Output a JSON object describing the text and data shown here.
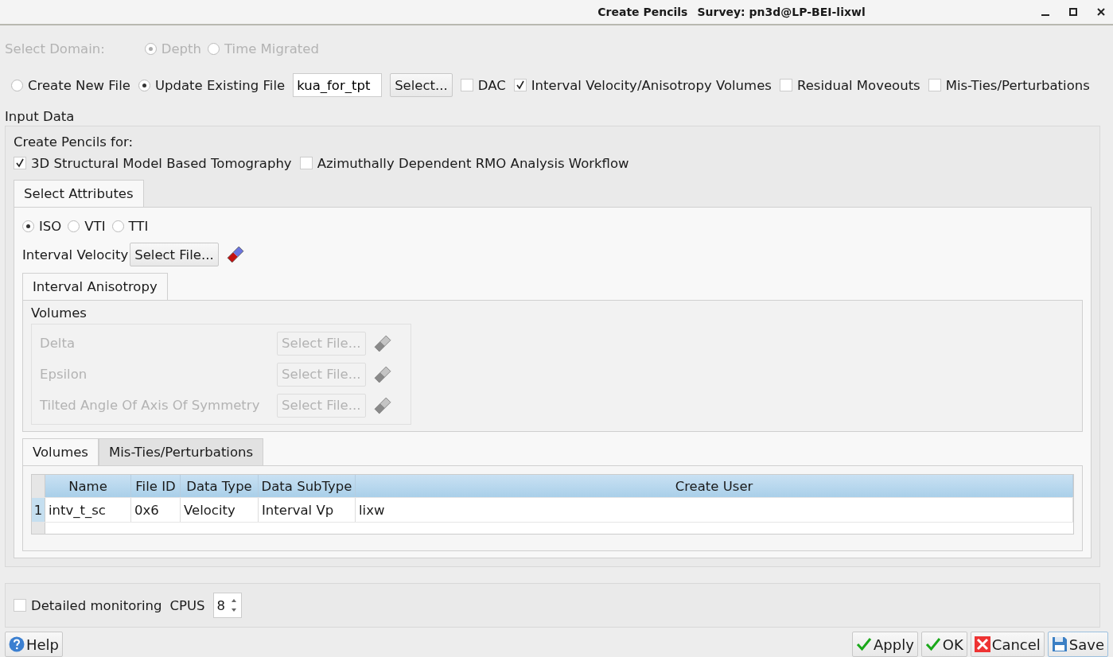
{
  "window": {
    "title": "Create Pencils",
    "subtitle": "Survey: pn3d@LP-BEI-lixwl"
  },
  "domain": {
    "label": "Select Domain:",
    "disabled": true,
    "options": [
      {
        "label": "Depth",
        "selected": true
      },
      {
        "label": "Time Migrated",
        "selected": false
      }
    ]
  },
  "file_mode": {
    "options": [
      {
        "label": "Create New File",
        "selected": false
      },
      {
        "label": "Update Existing File",
        "selected": true
      }
    ],
    "file_value": "kua_for_tpt",
    "select_button": "Select...",
    "outputs": [
      {
        "label": "DAC",
        "checked": false
      },
      {
        "label": "Interval Velocity/Anisotropy Volumes",
        "checked": true
      },
      {
        "label": "Residual Moveouts",
        "checked": false
      },
      {
        "label": "Mis-Ties/Perturbations",
        "checked": false
      }
    ]
  },
  "input_data": {
    "title": "Input Data",
    "create_for_label": "Create Pencils for:",
    "workflows": [
      {
        "label": "3D Structural Model Based Tomography",
        "checked": true
      },
      {
        "label": "Azimuthally Dependent RMO Analysis Workflow",
        "checked": false
      }
    ],
    "tabs": [
      {
        "label": "Select Attributes",
        "selected": true
      }
    ],
    "models": [
      {
        "label": "ISO",
        "selected": true
      },
      {
        "label": "VTI",
        "selected": false
      },
      {
        "label": "TTI",
        "selected": false
      }
    ],
    "interval_velocity": {
      "label": "Interval Velocity",
      "button": "Select File...",
      "disabled": false
    },
    "anisotropy_tabs": [
      {
        "label": "Interval Anisotropy",
        "selected": true
      }
    ],
    "volumes_title": "Volumes",
    "volumes": [
      {
        "label": "Delta",
        "button": "Select File...",
        "disabled": true
      },
      {
        "label": "Epsilon",
        "button": "Select File...",
        "disabled": true
      },
      {
        "label": "Tilted Angle Of Axis Of Symmetry",
        "button": "Select File...",
        "disabled": true
      }
    ],
    "table_tabs": [
      {
        "label": "Volumes",
        "selected": true
      },
      {
        "label": "Mis-Ties/Perturbations",
        "selected": false
      }
    ],
    "table": {
      "columns": [
        "Name",
        "File ID",
        "Data Type",
        "Data SubType",
        "Create User"
      ],
      "rows": [
        {
          "index": "1",
          "cells": [
            "intv_t_sc",
            "0x6",
            "Velocity",
            "Interval Vp",
            "lixw"
          ]
        }
      ]
    }
  },
  "monitoring": {
    "label": "Detailed monitoring",
    "checked": false,
    "cpus_label": "CPUS",
    "cpus_value": "8"
  },
  "buttons": [
    {
      "label": "Help",
      "kind": "help"
    },
    {
      "label": "Apply",
      "kind": "apply"
    },
    {
      "label": "OK",
      "kind": "ok"
    },
    {
      "label": "Cancel",
      "kind": "cancel"
    },
    {
      "label": "Save",
      "kind": "save"
    }
  ]
}
